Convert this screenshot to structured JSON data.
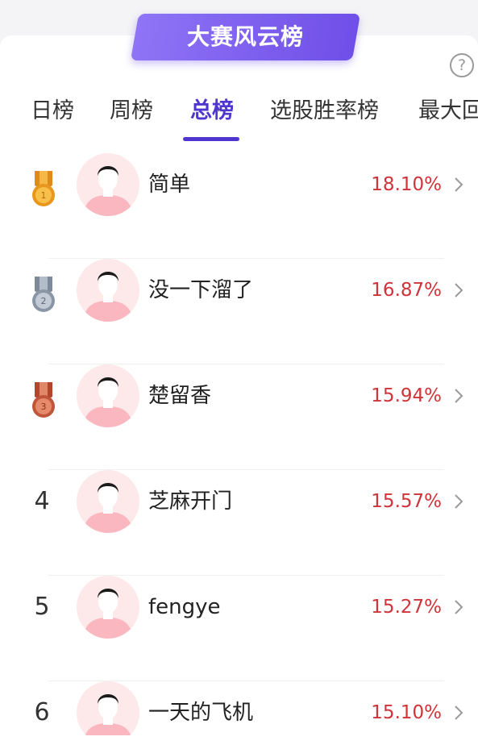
{
  "header": {
    "title": "大赛风云榜",
    "help_glyph": "?"
  },
  "tabs": [
    {
      "label": "日榜",
      "active": false
    },
    {
      "label": "周榜",
      "active": false
    },
    {
      "label": "总榜",
      "active": true
    },
    {
      "label": "选股胜率榜",
      "active": false
    },
    {
      "label": "最大回",
      "active": false
    }
  ],
  "ranking": [
    {
      "rank": "1",
      "medal": "gold-medal-icon",
      "name": "简单",
      "rate": "18.10%"
    },
    {
      "rank": "2",
      "medal": "silver-medal-icon",
      "name": "没一下溜了",
      "rate": "16.87%"
    },
    {
      "rank": "3",
      "medal": "bronze-medal-icon",
      "name": "楚留香",
      "rate": "15.94%"
    },
    {
      "rank": "4",
      "medal": null,
      "name": "芝麻开门",
      "rate": "15.57%"
    },
    {
      "rank": "5",
      "medal": null,
      "name": "fengye",
      "rate": "15.27%"
    },
    {
      "rank": "6",
      "medal": null,
      "name": "一天的飞机",
      "rate": "15.10%"
    }
  ],
  "colors": {
    "accent": "#4f36d0",
    "rate": "#d0333a",
    "banner": "#7a5cf0"
  }
}
